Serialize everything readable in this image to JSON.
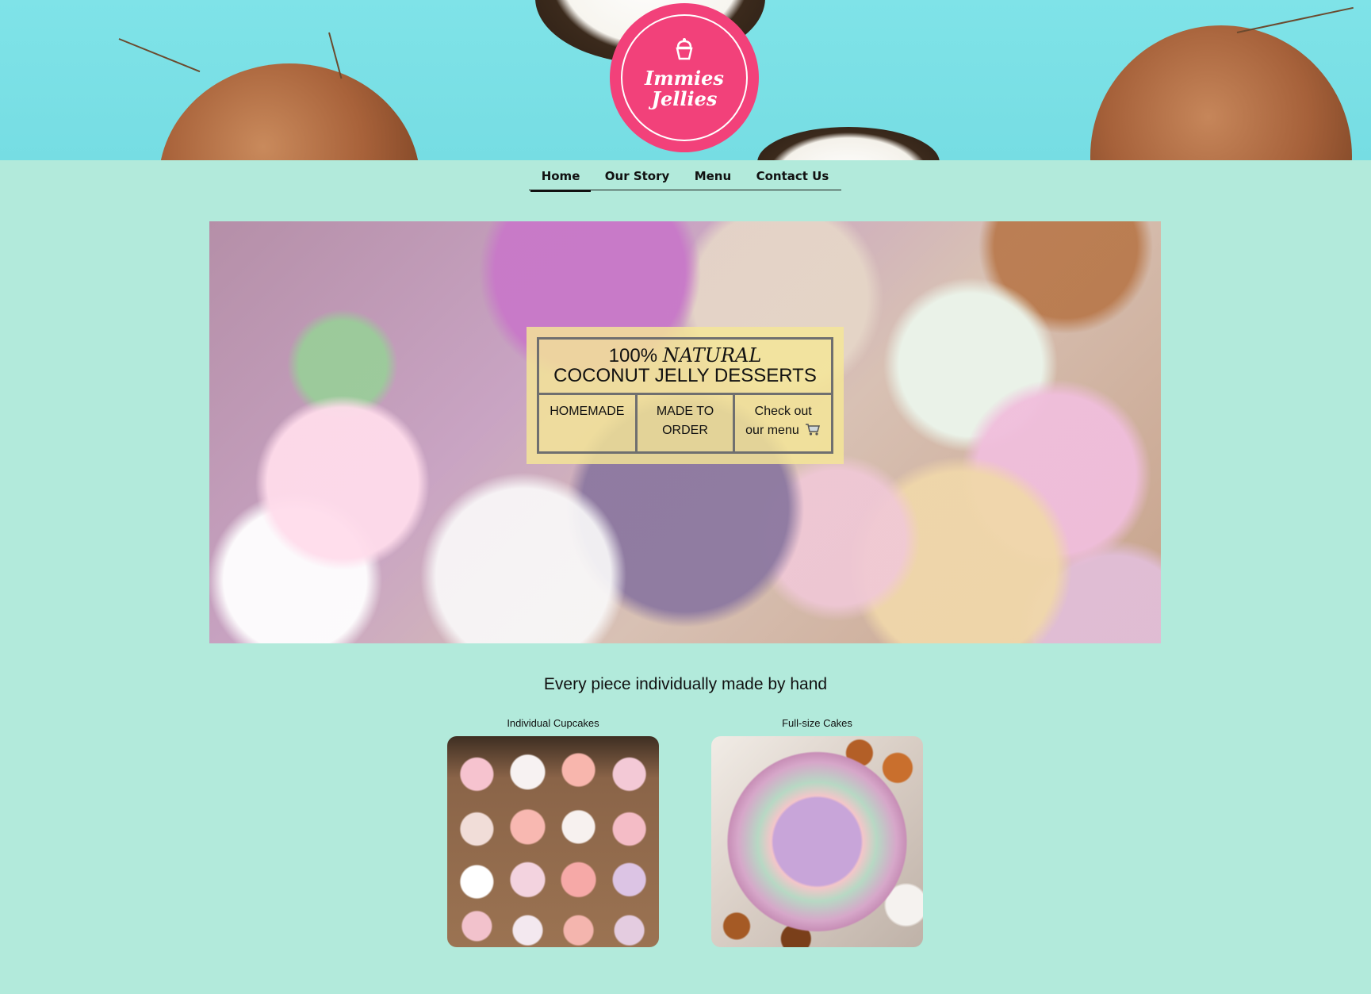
{
  "brand": {
    "logo_line1": "Immies",
    "logo_line2": "Jellies",
    "logo_icon": "cupcake-icon",
    "logo_color": "#f2417a"
  },
  "nav": {
    "items": [
      {
        "label": "Home",
        "active": true
      },
      {
        "label": "Our Story",
        "active": false
      },
      {
        "label": "Menu",
        "active": false
      },
      {
        "label": "Contact Us",
        "active": false
      }
    ]
  },
  "hero": {
    "title_prefix": "100%",
    "title_emph": "NATURAL",
    "title_line2": "COCONUT JELLY DESSERTS",
    "col1": "HOMEMADE",
    "col2_line1": "MADE TO",
    "col2_line2": "ORDER",
    "col3_line1": "Check out",
    "col3_line2": "our menu",
    "col3_icon": "cart-icon"
  },
  "tagline": "Every piece individually made by hand",
  "gallery": [
    {
      "label": "Individual Cupcakes"
    },
    {
      "label": "Full-size Cakes"
    }
  ],
  "colors": {
    "page_bg": "#b2eadb",
    "banner_bg": "#7fe3e8",
    "card_bg": "#f5e696"
  }
}
